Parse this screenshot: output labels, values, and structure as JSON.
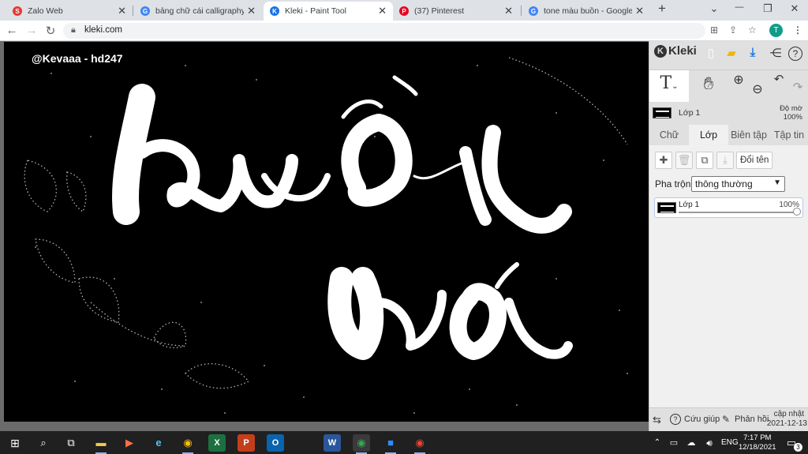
{
  "browser": {
    "tabs": [
      {
        "title": "Zalo Web",
        "favicon_color": "#e53935",
        "favicon_glyph": "S",
        "active": false
      },
      {
        "title": "bảng chữ cái calligraphy - Go",
        "favicon_color": "#4285f4",
        "favicon_glyph": "G",
        "active": false
      },
      {
        "title": "Kleki - Paint Tool",
        "favicon_color": "#1a73e8",
        "favicon_glyph": "K",
        "active": true
      },
      {
        "title": "(37) Pinterest",
        "favicon_color": "#e60023",
        "favicon_glyph": "P",
        "active": false
      },
      {
        "title": "tone màu buồn - Google Tìm",
        "favicon_color": "#4285f4",
        "favicon_glyph": "G",
        "active": false
      }
    ],
    "new_tab": "+",
    "controls": {
      "chevron": "⌄",
      "minimize": "—",
      "restore": "❐",
      "close": "✕"
    },
    "url": "kleki.com",
    "avatar_letter": "T"
  },
  "canvas": {
    "watermark": "@Kevaaa - hd247",
    "lettering": "buồn wá"
  },
  "kleki": {
    "logo": "Kleki",
    "layer_name": "Lớp 1",
    "opacity_label": "Độ mờ",
    "opacity_value": "100%",
    "tabs": [
      "Chữ",
      "Lớp",
      "Biên tập",
      "Tập tin"
    ],
    "selected_tab": "Lớp",
    "rename_button": "Đổi tên",
    "blend_label": "Pha trộn",
    "blend_value": "thông thường",
    "layer_card": {
      "name": "Lớp 1",
      "opacity": "100%"
    },
    "footer": {
      "help": "Cứu giúp",
      "feedback": "Phản hồi",
      "update_line1": "cập nhật",
      "update_line2": "2021-12-13"
    }
  },
  "taskbar": {
    "lang": "ENG",
    "time": "7:17 PM",
    "date": "12/18/2021",
    "notif_count": "3"
  }
}
